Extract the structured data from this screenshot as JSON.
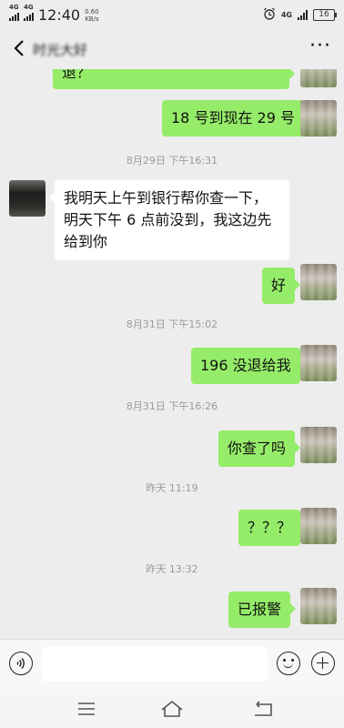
{
  "status_bar": {
    "network1": "4G",
    "network2": "4G",
    "time": "12:40",
    "speed_value": "0.60",
    "speed_unit": "KB/s",
    "network3": "4G",
    "battery": "16"
  },
  "header": {
    "title": "时光大好",
    "more": "···"
  },
  "messages": [
    {
      "from": "me",
      "text": "退？"
    },
    {
      "from": "me",
      "text": "18 号到现在 29 号"
    },
    {
      "timestamp": "8月29日 下午16:31"
    },
    {
      "from": "other",
      "text": "我明天上午到银行帮你查一下，明天下午 6 点前没到，我这边先给到你"
    },
    {
      "from": "me",
      "text": "好"
    },
    {
      "timestamp": "8月31日 下午15:02"
    },
    {
      "from": "me",
      "text": "196 没退给我"
    },
    {
      "timestamp": "8月31日 下午16:26"
    },
    {
      "from": "me",
      "text": "你查了吗"
    },
    {
      "timestamp": "昨天 11:19"
    },
    {
      "from": "me",
      "text": "？？？"
    },
    {
      "timestamp": "昨天 13:32"
    },
    {
      "from": "me",
      "text": "已报警"
    }
  ],
  "input": {
    "value": "",
    "placeholder": ""
  },
  "icons": {
    "back": "chevron-left-icon",
    "more": "more-dots-icon",
    "voice": "voice-icon",
    "emoji": "emoji-icon",
    "plus": "plus-icon",
    "nav_menu": "menu-icon",
    "nav_home": "home-icon",
    "nav_back": "back-icon"
  },
  "colors": {
    "background": "#ededed",
    "outgoing_bubble": "#95ec69",
    "incoming_bubble": "#ffffff",
    "timestamp_text": "#9a9a9a"
  }
}
